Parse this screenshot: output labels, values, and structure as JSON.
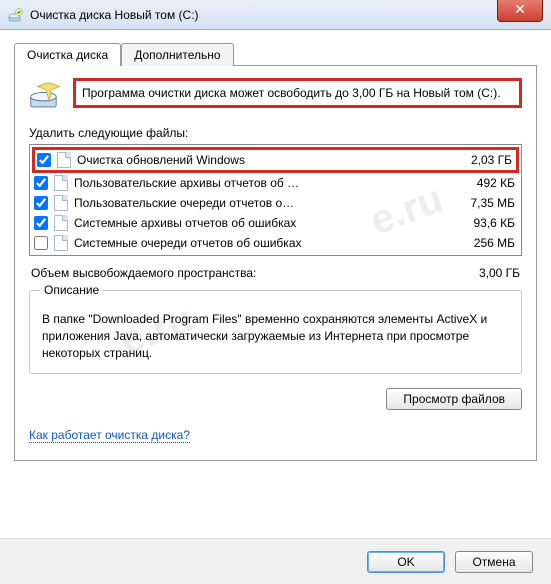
{
  "window": {
    "title": "Очистка диска Новый том (C:)"
  },
  "tabs": {
    "active": "Очистка диска",
    "other": "Дополнительно"
  },
  "info": "Программа очистки диска может освободить до 3,00 ГБ на Новый том (C:).",
  "delete_label": "Удалить следующие файлы:",
  "files": [
    {
      "label": "Очистка обновлений Windows",
      "size": "2,03 ГБ",
      "checked": true,
      "highlight": true
    },
    {
      "label": "Пользовательские архивы отчетов об …",
      "size": "492 КБ",
      "checked": true,
      "highlight": false
    },
    {
      "label": "Пользовательские очереди отчетов о…",
      "size": "7,35 МБ",
      "checked": true,
      "highlight": false
    },
    {
      "label": "Системные архивы отчетов об ошибках",
      "size": "93,6 КБ",
      "checked": true,
      "highlight": false
    },
    {
      "label": "Системные очереди отчетов об ошибках",
      "size": "256 МБ",
      "checked": false,
      "highlight": false
    }
  ],
  "freed": {
    "label": "Объем высвобождаемого пространства:",
    "value": "3,00 ГБ"
  },
  "description": {
    "legend": "Описание",
    "text": "В папке \"Downloaded Program Files\" временно сохраняются элементы ActiveX и приложения Java, автоматически загружаемые из Интернета при просмотре некоторых страниц."
  },
  "buttons": {
    "view_files": "Просмотр файлов",
    "ok": "OK",
    "cancel": "Отмена"
  },
  "link": "Как работает очистка диска?"
}
